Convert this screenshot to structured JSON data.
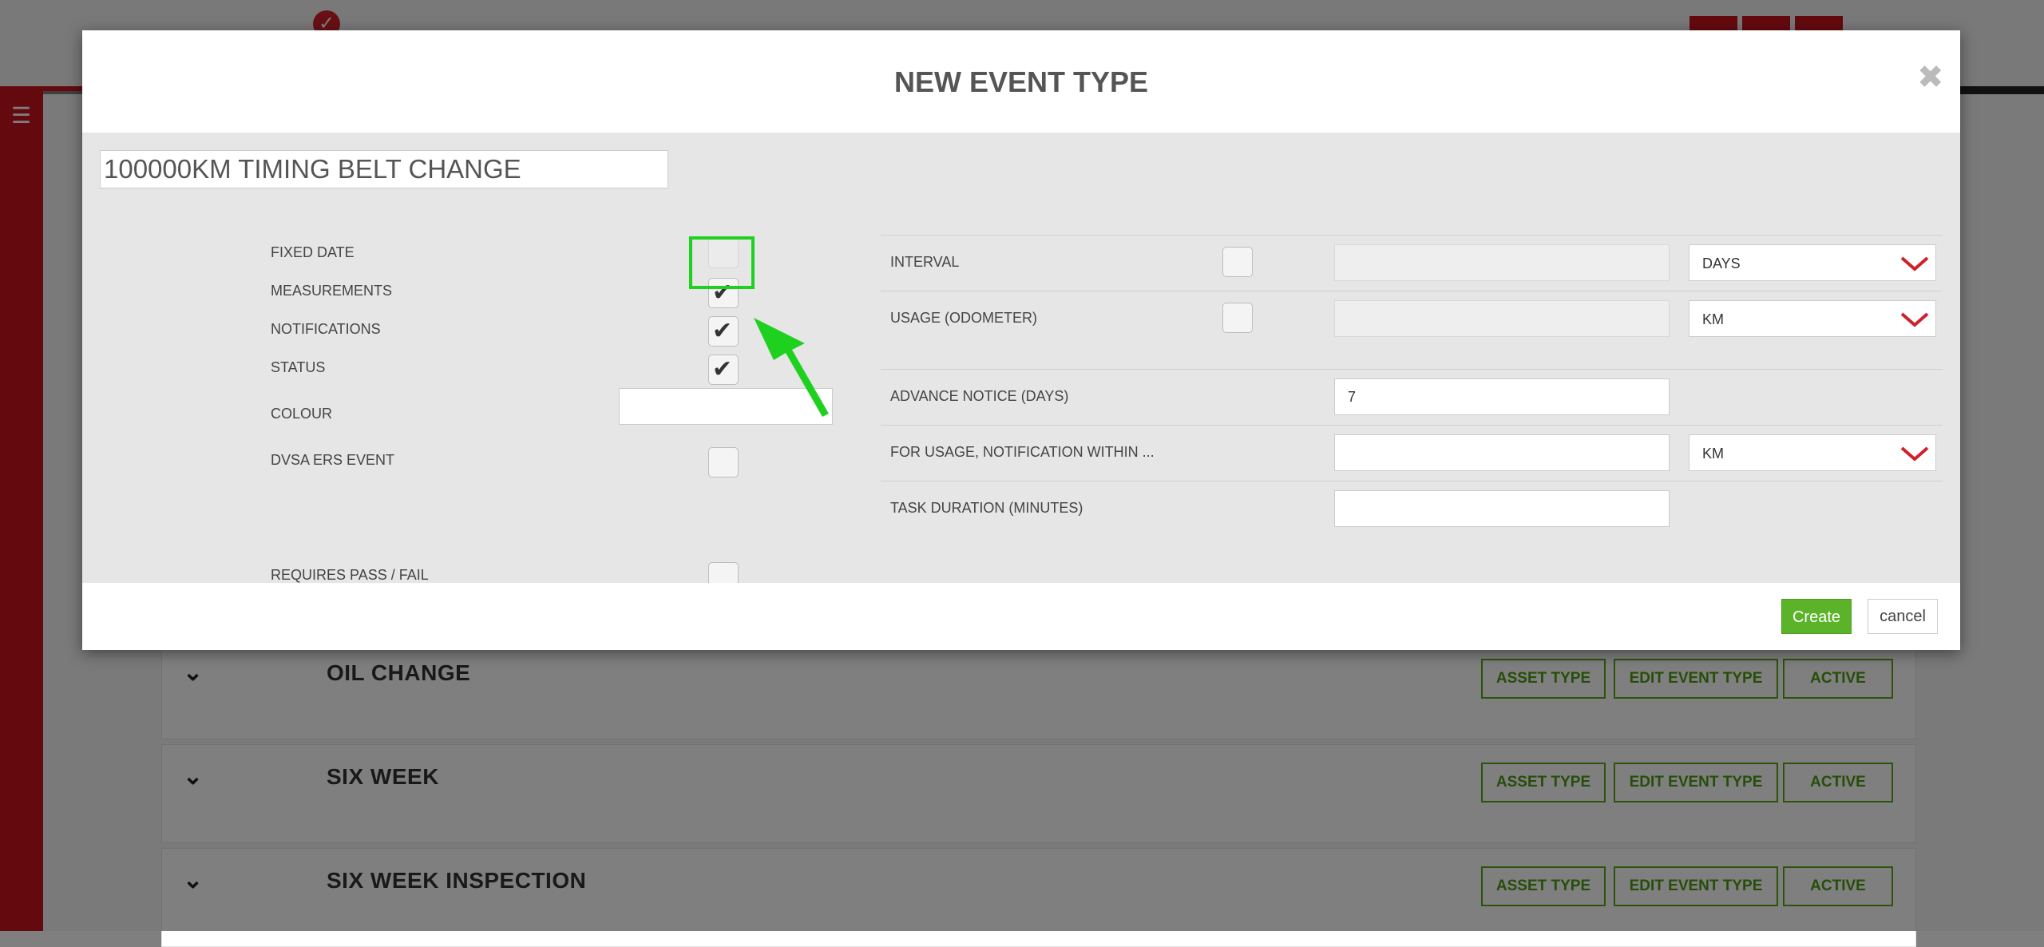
{
  "modal": {
    "title": "NEW EVENT TYPE",
    "close_icon": "close-icon",
    "name_value": "100000KM TIMING BELT CHANGE"
  },
  "left_options": [
    {
      "label": "FIXED DATE",
      "checked": false
    },
    {
      "label": "MEASUREMENTS",
      "checked": true
    },
    {
      "label": "NOTIFICATIONS",
      "checked": true
    },
    {
      "label": "STATUS",
      "checked": true
    },
    {
      "label": "COLOUR",
      "value": ""
    },
    {
      "label": "DVSA ERS EVENT",
      "checked": false
    },
    {
      "label": "REQUIRES PASS / FAIL",
      "checked": false
    }
  ],
  "right_options": {
    "interval": {
      "label": "INTERVAL",
      "checked": false,
      "value": "",
      "unit": "DAYS"
    },
    "usage": {
      "label": "USAGE (ODOMETER)",
      "checked": false,
      "value": "",
      "unit": "KM"
    },
    "advance_notice": {
      "label": "ADVANCE NOTICE (DAYS)",
      "value": "7"
    },
    "usage_notification": {
      "label": "FOR USAGE, NOTIFICATION WITHIN ...",
      "value": "",
      "unit": "KM"
    },
    "task_duration": {
      "label": "TASK DURATION (MINUTES)",
      "value": ""
    }
  },
  "footer": {
    "create_label": "Create",
    "cancel_label": "cancel"
  },
  "background_rows": [
    {
      "title": "OIL CHANGE",
      "btn_asset": "ASSET TYPE",
      "btn_edit": "EDIT EVENT TYPE",
      "btn_active": "ACTIVE"
    },
    {
      "title": "SIX WEEK",
      "btn_asset": "ASSET TYPE",
      "btn_edit": "EDIT EVENT TYPE",
      "btn_active": "ACTIVE"
    },
    {
      "title": "SIX WEEK INSPECTION",
      "btn_asset": "ASSET TYPE",
      "btn_edit": "EDIT EVENT TYPE",
      "btn_active": "ACTIVE"
    }
  ],
  "colors": {
    "brand_red": "#c8141f",
    "accent_green": "#5bb32a",
    "highlight_green": "#1fd11f",
    "dropdown_arrow": "#d0202a"
  }
}
